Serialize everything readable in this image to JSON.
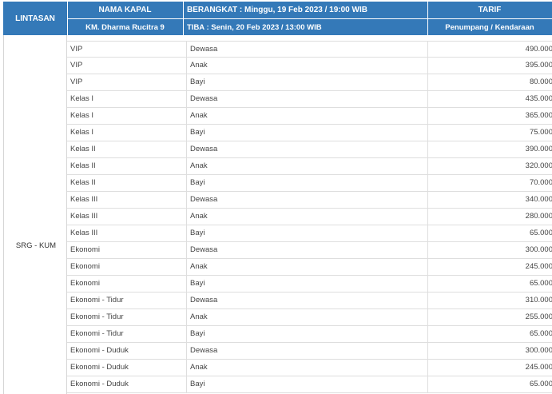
{
  "header": {
    "lintasan_label": "LINTASAN",
    "nama_kapal_label": "NAMA KAPAL",
    "ship_name": "KM. Dharma Rucitra 9",
    "berangkat": "BERANGKAT : Minggu, 19 Feb 2023 / 19:00 WIB",
    "tiba": "TIBA : Senin, 20 Feb 2023 / 13:00 WIB",
    "tarif_label": "TARIF",
    "tarif_sub": "Penumpang / Kendaraan"
  },
  "route": "SRG - KUM",
  "rows": [
    {
      "kelas": "VIP",
      "kategori": "Dewasa",
      "tarif": "490.000"
    },
    {
      "kelas": "VIP",
      "kategori": "Anak",
      "tarif": "395.000"
    },
    {
      "kelas": "VIP",
      "kategori": "Bayi",
      "tarif": "80.000"
    },
    {
      "kelas": "Kelas I",
      "kategori": "Dewasa",
      "tarif": "435.000"
    },
    {
      "kelas": "Kelas I",
      "kategori": "Anak",
      "tarif": "365.000"
    },
    {
      "kelas": "Kelas I",
      "kategori": "Bayi",
      "tarif": "75.000"
    },
    {
      "kelas": "Kelas II",
      "kategori": "Dewasa",
      "tarif": "390.000"
    },
    {
      "kelas": "Kelas II",
      "kategori": "Anak",
      "tarif": "320.000"
    },
    {
      "kelas": "Kelas II",
      "kategori": "Bayi",
      "tarif": "70.000"
    },
    {
      "kelas": "Kelas III",
      "kategori": "Dewasa",
      "tarif": "340.000"
    },
    {
      "kelas": "Kelas III",
      "kategori": "Anak",
      "tarif": "280.000"
    },
    {
      "kelas": "Kelas III",
      "kategori": "Bayi",
      "tarif": "65.000"
    },
    {
      "kelas": "Ekonomi",
      "kategori": "Dewasa",
      "tarif": "300.000"
    },
    {
      "kelas": "Ekonomi",
      "kategori": "Anak",
      "tarif": "245.000"
    },
    {
      "kelas": "Ekonomi",
      "kategori": "Bayi",
      "tarif": "65.000"
    },
    {
      "kelas": "Ekonomi - Tidur",
      "kategori": "Dewasa",
      "tarif": "310.000"
    },
    {
      "kelas": "Ekonomi - Tidur",
      "kategori": "Anak",
      "tarif": "255.000"
    },
    {
      "kelas": "Ekonomi - Tidur",
      "kategori": "Bayi",
      "tarif": "65.000"
    },
    {
      "kelas": "Ekonomi - Duduk",
      "kategori": "Dewasa",
      "tarif": "300.000"
    },
    {
      "kelas": "Ekonomi - Duduk",
      "kategori": "Anak",
      "tarif": "245.000"
    },
    {
      "kelas": "Ekonomi - Duduk",
      "kategori": "Bayi",
      "tarif": "65.000"
    }
  ],
  "colors": {
    "header_bg": "#3479b8"
  }
}
